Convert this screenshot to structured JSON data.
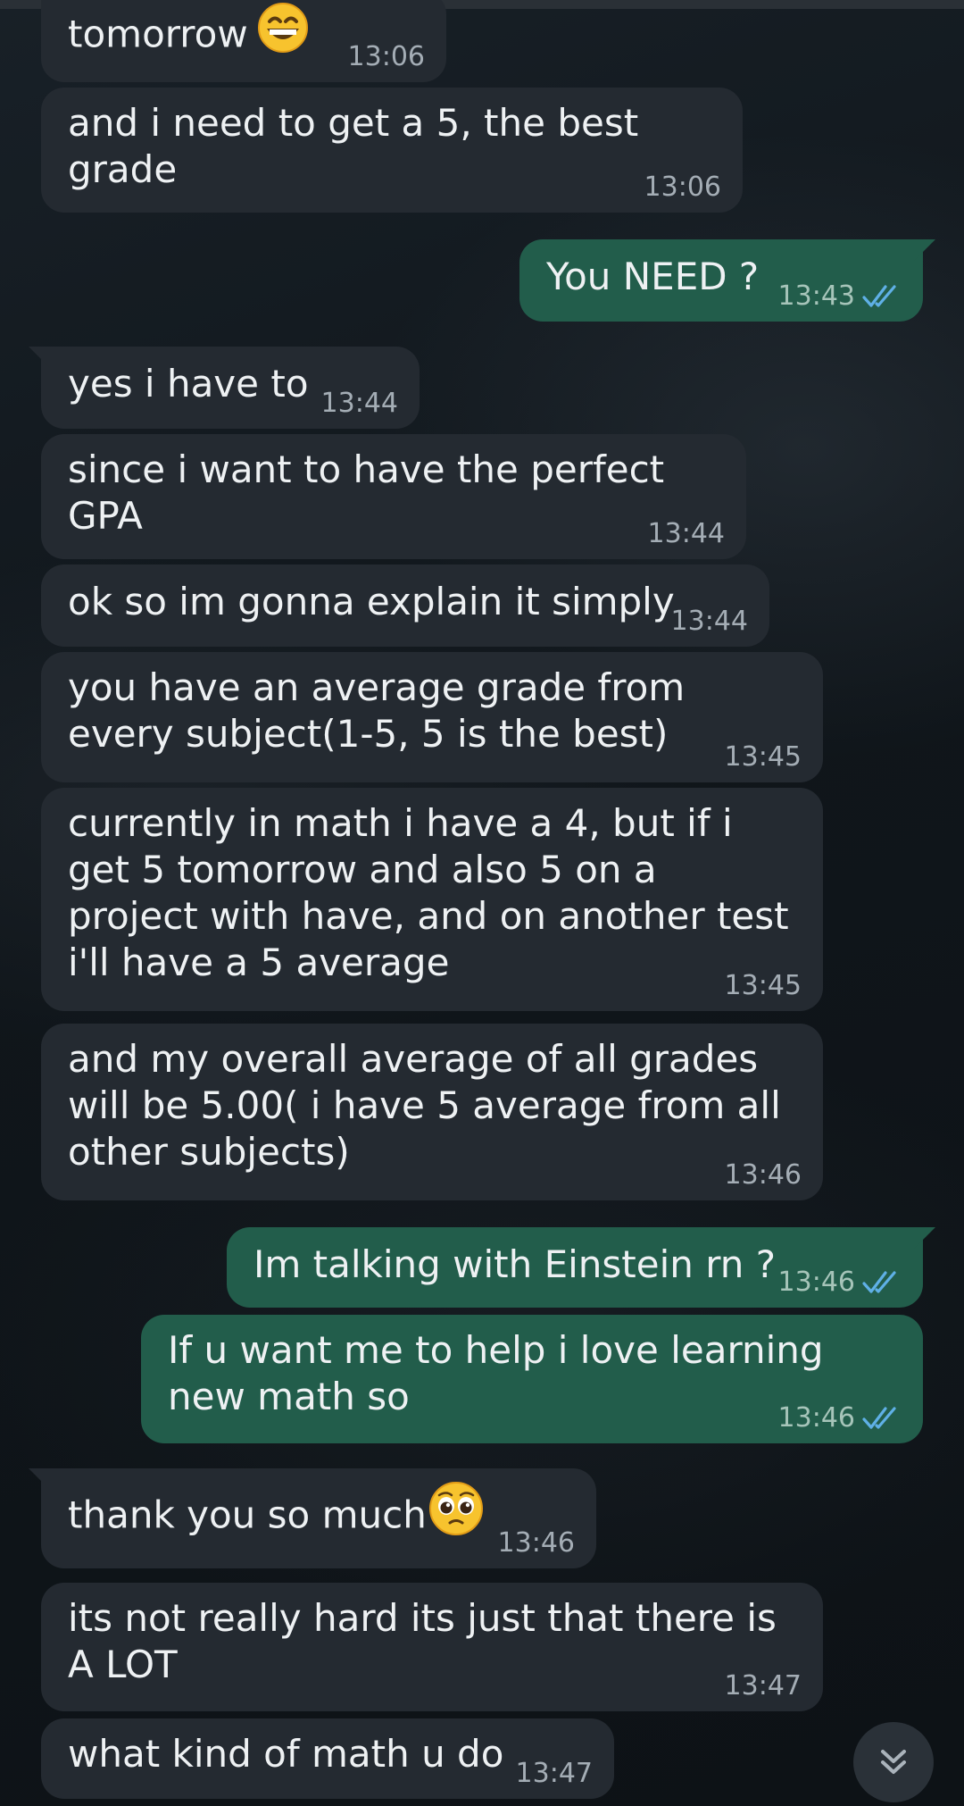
{
  "messages": [
    {
      "dir": "in",
      "text": "tomorrow",
      "emoji": "grinning-face",
      "time": "13:06"
    },
    {
      "dir": "in",
      "text": "and i need to get a 5, the best grade",
      "time": "13:06"
    },
    {
      "dir": "out",
      "text": "You NEED ?",
      "time": "13:43",
      "status": "read"
    },
    {
      "dir": "in",
      "text": "yes i have to",
      "time": "13:44"
    },
    {
      "dir": "in",
      "text": "since i want to have the perfect GPA",
      "time": "13:44"
    },
    {
      "dir": "in",
      "text": "ok so im gonna explain it simply",
      "time": "13:44"
    },
    {
      "dir": "in",
      "text": "you have an average grade from every subject(1-5, 5 is the best)",
      "time": "13:45"
    },
    {
      "dir": "in",
      "text": "currently in math i have a 4, but if i get 5 tomorrow and also 5 on a project with have, and on another test i'll have a 5 average",
      "time": "13:45"
    },
    {
      "dir": "in",
      "text": "and my overall average of all grades will be 5.00( i have 5 average from all other subjects)",
      "time": "13:46"
    },
    {
      "dir": "out",
      "text": "Im talking with Einstein rn ?",
      "time": "13:46",
      "status": "read"
    },
    {
      "dir": "out",
      "text": "If u want me to help i love learning new math so",
      "time": "13:46",
      "status": "read"
    },
    {
      "dir": "in",
      "text": "thank you so much",
      "emoji": "pleading-face",
      "time": "13:46"
    },
    {
      "dir": "in",
      "text": "its not really hard its just that there is A LOT",
      "time": "13:47"
    },
    {
      "dir": "in",
      "text": "what kind of math u do",
      "time": "13:47"
    }
  ],
  "theme": {
    "incoming_bubble": "#242a31",
    "outgoing_bubble": "#225d4b",
    "read_ticks": "#5fb0e6"
  },
  "icons": {
    "read_status": "double-check-icon",
    "scroll_button": "double-chevron-down-icon"
  }
}
